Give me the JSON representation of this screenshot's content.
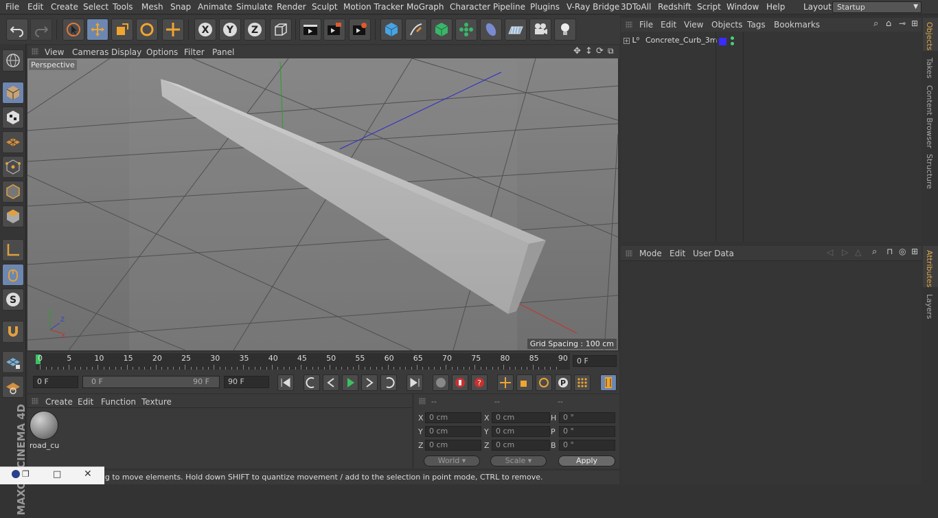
{
  "menubar": {
    "items": [
      "File",
      "Edit",
      "Create",
      "Select",
      "Tools",
      "Mesh",
      "Snap",
      "Animate",
      "Simulate",
      "Render",
      "Sculpt",
      "Motion Tracker",
      "MoGraph",
      "Character",
      "Pipeline",
      "Plugins",
      "V-Ray Bridge",
      "3DToAll",
      "Redshift",
      "Script",
      "Window",
      "Help"
    ],
    "layout_label": "Layout:",
    "layout_value": "Startup"
  },
  "toolbar": {
    "icons": [
      "undo-icon",
      "redo-icon",
      "live-selection-icon",
      "move-icon",
      "scale-icon",
      "rotate-icon",
      "recent-tool-icon",
      "x-axis-icon",
      "y-axis-icon",
      "z-axis-icon",
      "coordinate-system-icon",
      "render-view-icon",
      "render-picture-viewer-icon",
      "render-settings-icon",
      "cube-icon",
      "pen-icon",
      "subdivision-icon",
      "cloner-icon",
      "deformer-icon",
      "floor-icon",
      "camera-icon",
      "light-icon"
    ]
  },
  "viewport": {
    "menu": [
      "View",
      "Cameras",
      "Display",
      "Options",
      "Filter",
      "Panel"
    ],
    "camera_label": "Perspective",
    "grid_spacing": "Grid Spacing : 100 cm"
  },
  "timeline": {
    "ticks": [
      "0",
      "5",
      "10",
      "15",
      "20",
      "25",
      "30",
      "35",
      "40",
      "45",
      "50",
      "55",
      "60",
      "65",
      "70",
      "75",
      "80",
      "85",
      "90"
    ],
    "current_frame": "0 F"
  },
  "transport": {
    "start_field": "0 F",
    "range_start": "0 F",
    "range_end": "90 F",
    "end_field": "90 F"
  },
  "materials": {
    "menu": [
      "Create",
      "Edit",
      "Function",
      "Texture"
    ],
    "items": [
      {
        "name": "road_cu"
      }
    ]
  },
  "coords": {
    "col_headers": [
      "--",
      "--",
      "--"
    ],
    "rows": [
      {
        "l1": "X",
        "v1": "0 cm",
        "l2": "X",
        "v2": "0 cm",
        "l3": "H",
        "v3": "0 °"
      },
      {
        "l1": "Y",
        "v1": "0 cm",
        "l2": "Y",
        "v2": "0 cm",
        "l3": "P",
        "v3": "0 °"
      },
      {
        "l1": "Z",
        "v1": "0 cm",
        "l2": "Z",
        "v2": "0 cm",
        "l3": "B",
        "v3": "0 °"
      }
    ],
    "space": "World",
    "mode": "Scale",
    "apply": "Apply"
  },
  "status": {
    "text": "Move: Click and drag to move elements. Hold down SHIFT to quantize movement / add to the selection in point mode, CTRL to remove."
  },
  "objects": {
    "menu": [
      "File",
      "Edit",
      "View",
      "Objects",
      "Tags",
      "Bookmarks"
    ],
    "items": [
      {
        "name": "Concrete_Curb_3m",
        "color": "#3a2bff"
      }
    ]
  },
  "attributes": {
    "menu": [
      "Mode",
      "Edit",
      "User Data"
    ]
  },
  "righttabs": [
    "Objects",
    "Takes",
    "Content Browser",
    "Structure",
    "Attributes",
    "Layers"
  ],
  "brand": {
    "text": "MAXON CINEMA 4D"
  },
  "colors": {
    "accent_active": "#6d87b0",
    "tab_active": "#e0a94a"
  }
}
